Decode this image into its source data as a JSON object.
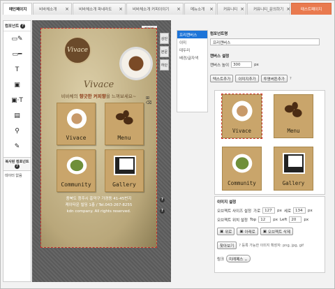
{
  "tabs": [
    {
      "label": "메인페이지",
      "close": "×",
      "state": "active"
    },
    {
      "label": "비바체소개",
      "close": "×"
    },
    {
      "label": "비바체소개 파네라도",
      "close": "×"
    },
    {
      "label": "비바체소개 커피이야기",
      "close": "×"
    },
    {
      "label": "메뉴소개",
      "close": "×"
    },
    {
      "label": "커뮤니티",
      "close": "×"
    },
    {
      "label": "커뮤니티_문의하기",
      "close": "×"
    },
    {
      "label": "태스트페이지",
      "close": ""
    }
  ],
  "left": {
    "header": "컴포넌트",
    "help": "?",
    "tools": [
      {
        "glyph": "▭✎"
      },
      {
        "glyph": "▭━"
      },
      {
        "glyph": "T"
      },
      {
        "glyph": "▣"
      },
      {
        "glyph": "▣·T"
      },
      {
        "glyph": "▤"
      },
      {
        "glyph": "⚲"
      },
      {
        "glyph": "✎"
      }
    ],
    "compound_title": "복사된 컴포넌트",
    "compound_help": "?",
    "compound_empty": "데이터 없음"
  },
  "canvas": {
    "page_button": "페이지",
    "side_buttons": [
      "상단",
      "본문",
      "하단"
    ],
    "logo_text": "Vivace",
    "brand_name": "Vivace",
    "tagline_pre": "비바체의 ",
    "tagline_em": "향긋한 커피향",
    "tagline_post": "을 느껴보세요~",
    "icons": "⊞ ⌫",
    "tiles": [
      "Vivace",
      "Menu",
      "Community",
      "Gallery"
    ],
    "footer_lines": [
      "충북도 청주시 흥덕구 가경동 41-45번지",
      "케이타운 빌딩 1층 / Tel.043-267-8255",
      "kdn company. All rights reserved."
    ],
    "help_marks": [
      "?",
      "?"
    ]
  },
  "tree": [
    "프리캔버스",
    "이미",
    "테두리",
    "배경/글자색"
  ],
  "props": {
    "component_name_label": "컴포넌트명",
    "component_name_value": "프리캔버스",
    "canvas_settings_label": "캔버스 설정",
    "canvas_height_label": "캔버스 높이",
    "canvas_height_value": "300",
    "canvas_height_unit": "px",
    "add_text_button": "텍스트추가",
    "add_image_button": "이미지추가",
    "add_transparent_button": "투명버튼추가",
    "help": "?"
  },
  "image_tiles": [
    "Vivace",
    "Menu",
    "Community",
    "Gallery"
  ],
  "image_settings": {
    "title": "이미지 설정",
    "size_label": "오브젝트 사이즈 설정",
    "width_label": "가로",
    "width_value": "127",
    "width_unit": "px",
    "height_label": "세로",
    "height_value": "134",
    "height_unit": "px",
    "pos_label": "오브젝트 위치 설정",
    "top_label": "Top",
    "top_value": "12",
    "top_unit": "px",
    "left_label": "Left",
    "left_value": "20",
    "left_unit": "px",
    "up_button": "위로",
    "down_button": "아래로",
    "delete_button": "오브젝트 삭제",
    "browse_button": "찾아보기",
    "browse_hint": "? 등록 가능한 이미지 확장자: png, jpg, gif",
    "link_label": "링크",
    "link_value": "미래페스 ⌄"
  }
}
